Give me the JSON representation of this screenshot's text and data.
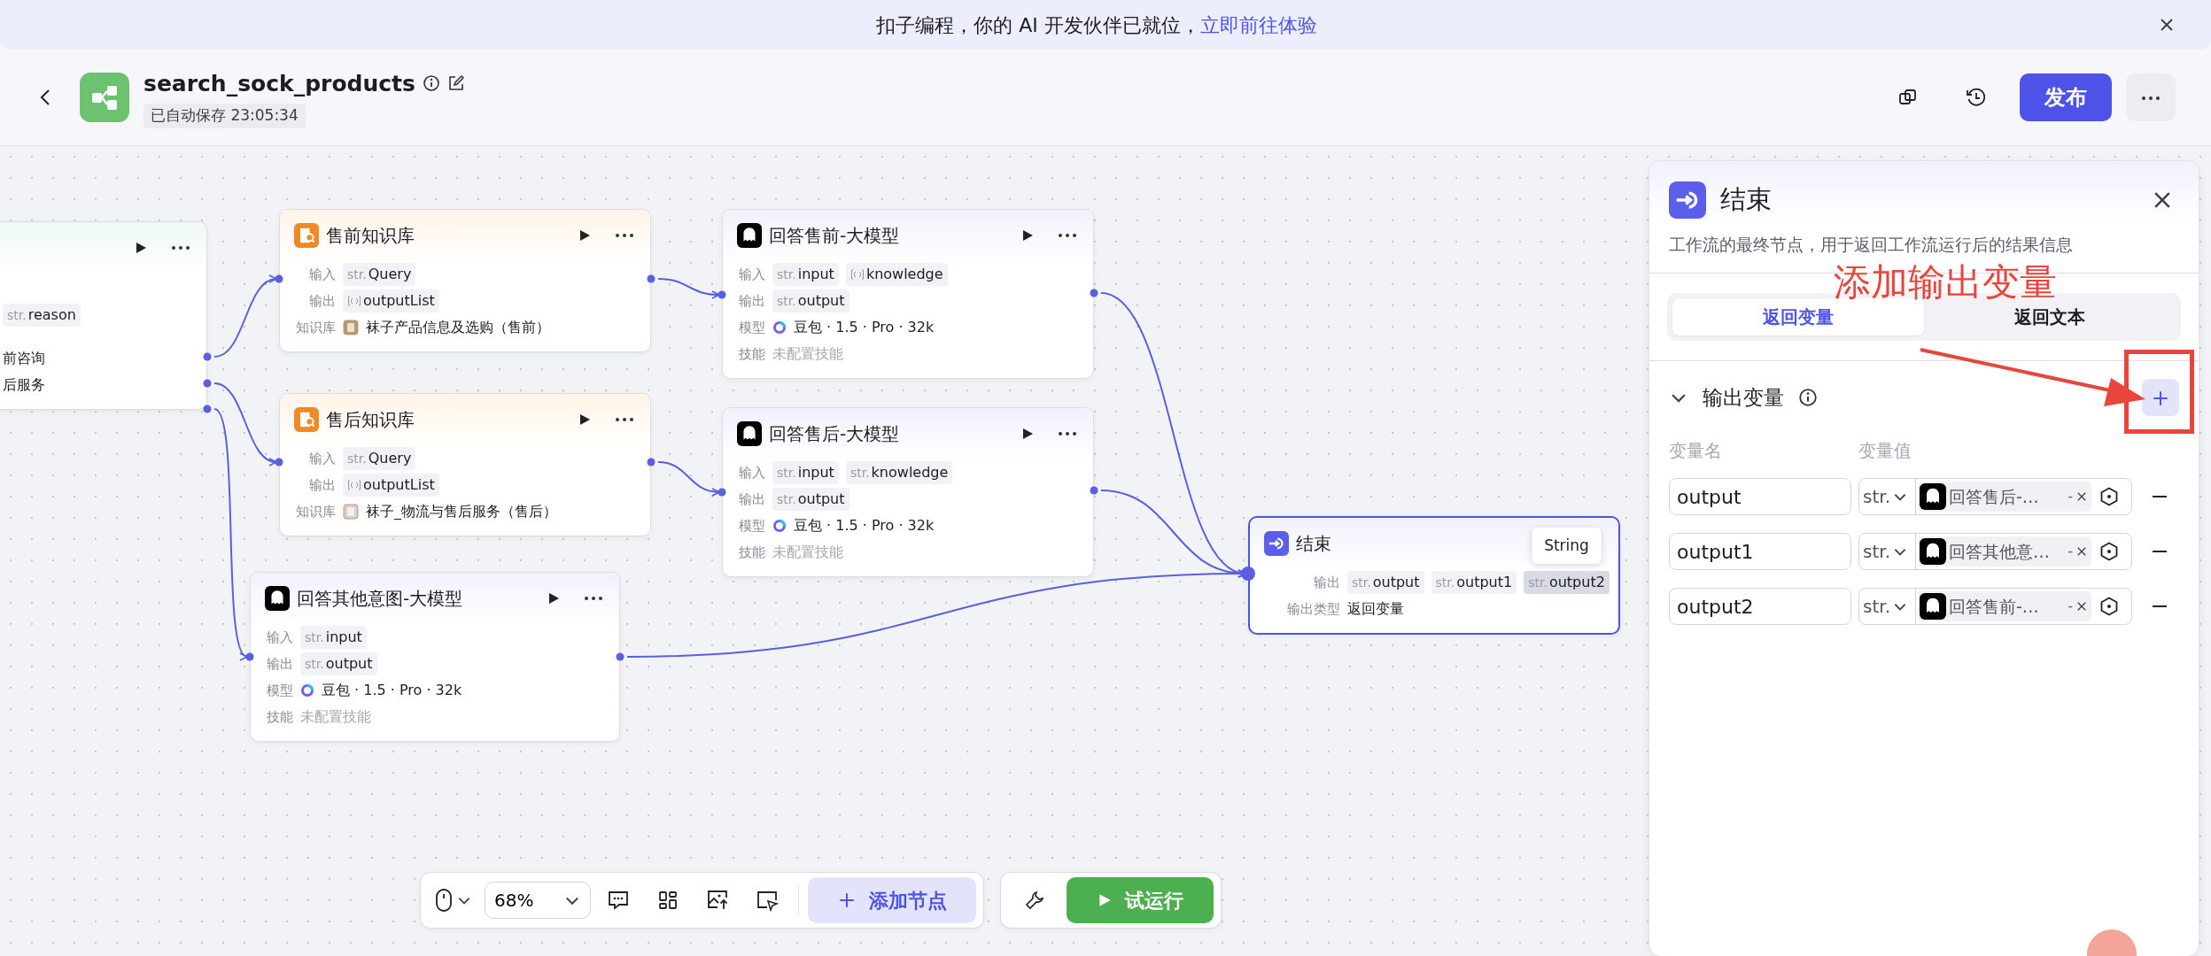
{
  "banner": {
    "text": "扣子编程，你的 AI 开发伙伴已就位，",
    "link": "立即前往体验"
  },
  "header": {
    "title": "search_sock_products",
    "autosave": "已自动保存 23:05:34",
    "publish": "发布"
  },
  "nodes": [
    {
      "kind": "partial",
      "selected": false,
      "rows": [
        {
          "kind": "tags",
          "tags": [
            {
              "kind": "string",
              "prefix": "str.",
              "name": "reason"
            }
          ]
        },
        {
          "kind": "text",
          "text": "前咨询"
        },
        {
          "kind": "text",
          "text": "后服务"
        }
      ]
    },
    {
      "kind": "knowledge",
      "selected": false,
      "title": "售前知识库",
      "rows": [
        {
          "kind": "tags",
          "label": "输入",
          "tags": [
            {
              "kind": "string",
              "prefix": "str.",
              "name": "Query"
            }
          ]
        },
        {
          "kind": "tags",
          "label": "输出",
          "tags": [
            {
              "kind": "array",
              "name": "outputList"
            }
          ]
        },
        {
          "kind": "dataset",
          "label": "知识库",
          "text": "袜子产品信息及选购（售前）",
          "color": "#b89a6a"
        }
      ]
    },
    {
      "kind": "knowledge",
      "selected": false,
      "title": "售后知识库",
      "rows": [
        {
          "kind": "tags",
          "label": "输入",
          "tags": [
            {
              "kind": "string",
              "prefix": "str.",
              "name": "Query"
            }
          ]
        },
        {
          "kind": "tags",
          "label": "输出",
          "tags": [
            {
              "kind": "array",
              "name": "outputList"
            }
          ]
        },
        {
          "kind": "dataset",
          "label": "知识库",
          "text": "袜子_物流与售后服务（售后）",
          "color": "#d9cfc4"
        }
      ]
    },
    {
      "kind": "llm",
      "selected": false,
      "title": "回答其他意图-大模型",
      "rows": [
        {
          "kind": "tags",
          "label": "输入",
          "tags": [
            {
              "kind": "string",
              "prefix": "str.",
              "name": "input"
            }
          ]
        },
        {
          "kind": "tags",
          "label": "输出",
          "tags": [
            {
              "kind": "string",
              "prefix": "str.",
              "name": "output"
            }
          ]
        },
        {
          "kind": "model",
          "label": "模型",
          "text": "豆包 · 1.5 · Pro · 32k"
        },
        {
          "kind": "muted",
          "label": "技能",
          "text": "未配置技能"
        }
      ]
    },
    {
      "kind": "llm",
      "selected": false,
      "title": "回答售前-大模型",
      "rows": [
        {
          "kind": "tags",
          "label": "输入",
          "tags": [
            {
              "kind": "string",
              "prefix": "str.",
              "name": "input"
            },
            {
              "kind": "array",
              "name": "knowledge"
            }
          ]
        },
        {
          "kind": "tags",
          "label": "输出",
          "tags": [
            {
              "kind": "string",
              "prefix": "str.",
              "name": "output"
            }
          ]
        },
        {
          "kind": "model",
          "label": "模型",
          "text": "豆包 · 1.5 · Pro · 32k"
        },
        {
          "kind": "muted",
          "label": "技能",
          "text": "未配置技能"
        }
      ]
    },
    {
      "kind": "llm",
      "selected": false,
      "title": "回答售后-大模型",
      "rows": [
        {
          "kind": "tags",
          "label": "输入",
          "tags": [
            {
              "kind": "string",
              "prefix": "str.",
              "name": "input"
            },
            {
              "kind": "string",
              "prefix": "str.",
              "name": "knowledge"
            }
          ]
        },
        {
          "kind": "tags",
          "label": "输出",
          "tags": [
            {
              "kind": "string",
              "prefix": "str.",
              "name": "output"
            }
          ]
        },
        {
          "kind": "model",
          "label": "模型",
          "text": "豆包 · 1.5 · Pro · 32k"
        },
        {
          "kind": "muted",
          "label": "技能",
          "text": "未配置技能"
        }
      ]
    },
    {
      "kind": "end",
      "selected": true,
      "title": "结束",
      "rows": [
        {
          "kind": "tags",
          "label": "输出",
          "tags": [
            {
              "kind": "string",
              "prefix": "str.",
              "name": "output",
              "hovered": false
            },
            {
              "kind": "string",
              "prefix": "str.",
              "name": "output1",
              "hovered": false
            },
            {
              "kind": "string",
              "prefix": "str.",
              "name": "output2",
              "hovered": true,
              "tooltip": "String"
            }
          ]
        },
        {
          "kind": "text",
          "label": "输出类型",
          "text": "返回变量"
        }
      ]
    }
  ],
  "panel": {
    "title": "结束",
    "description": "工作流的最终节点，用于返回工作流运行后的结果信息",
    "tabs": [
      {
        "label": "返回变量",
        "selected": true
      },
      {
        "label": "返回文本",
        "selected": false
      }
    ],
    "section": {
      "title": "输出变量",
      "expanded": true,
      "columns": [
        "变量名",
        "变量值"
      ],
      "rows": [
        {
          "name": "output",
          "type": "str.",
          "ref": "回答售后-…",
          "ref_suffix": "-"
        },
        {
          "name": "output1",
          "type": "str.",
          "ref": "回答其他意…",
          "ref_suffix": "-"
        },
        {
          "name": "output2",
          "type": "str.",
          "ref": "回答售前-…",
          "ref_suffix": "-"
        }
      ]
    }
  },
  "annotation": {
    "text": "添加输出变量"
  },
  "toolbar": {
    "zoom": "68%",
    "add_node": "添加节点",
    "test_run": "试运行"
  }
}
